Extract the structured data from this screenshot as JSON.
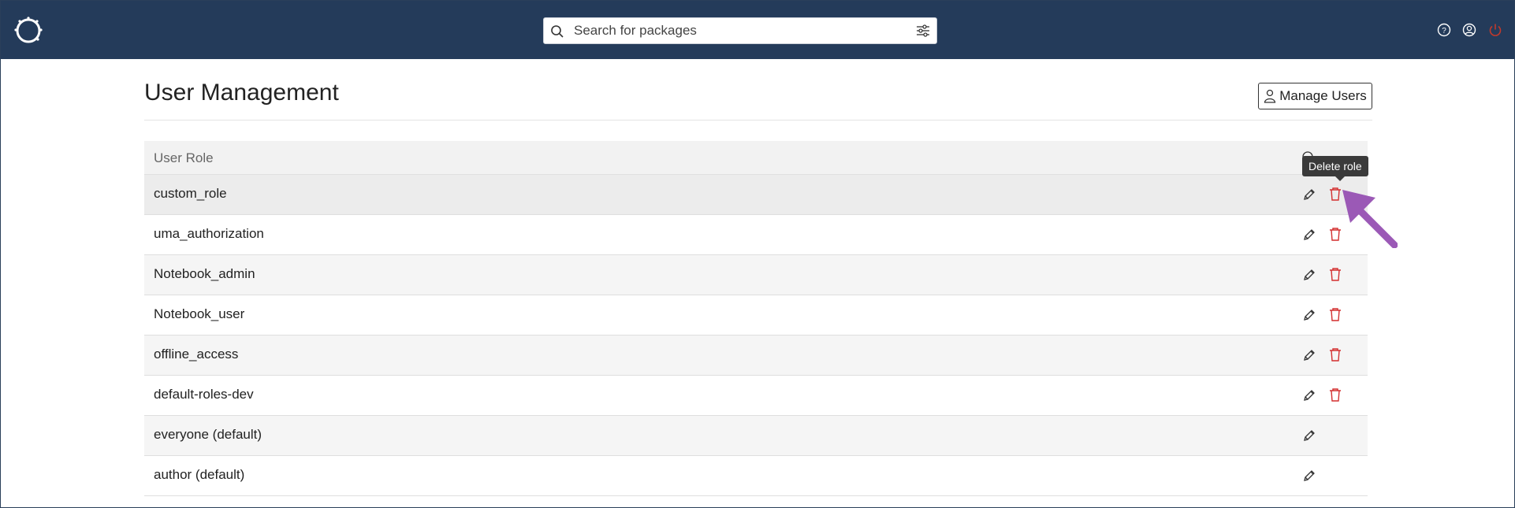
{
  "header": {
    "search_placeholder": "Search for packages",
    "icons": [
      "logo-icon",
      "search-icon",
      "filter-icon",
      "help-icon",
      "account-icon",
      "power-icon"
    ]
  },
  "page": {
    "title": "User Management",
    "manage_users_label": "Manage Users"
  },
  "table": {
    "column_header": "User Role",
    "rows": [
      {
        "name": "custom_role",
        "deletable": true
      },
      {
        "name": "uma_authorization",
        "deletable": true
      },
      {
        "name": "Notebook_admin",
        "deletable": true
      },
      {
        "name": "Notebook_user",
        "deletable": true
      },
      {
        "name": "offline_access",
        "deletable": true
      },
      {
        "name": "default-roles-dev",
        "deletable": true
      },
      {
        "name": "everyone (default)",
        "deletable": false
      },
      {
        "name": "author (default)",
        "deletable": false
      }
    ]
  },
  "tooltip": {
    "text": "Delete role"
  },
  "colors": {
    "header_bg": "#243b5a",
    "delete_red": "#d32f2f",
    "annotation_arrow": "#9b59b6"
  }
}
